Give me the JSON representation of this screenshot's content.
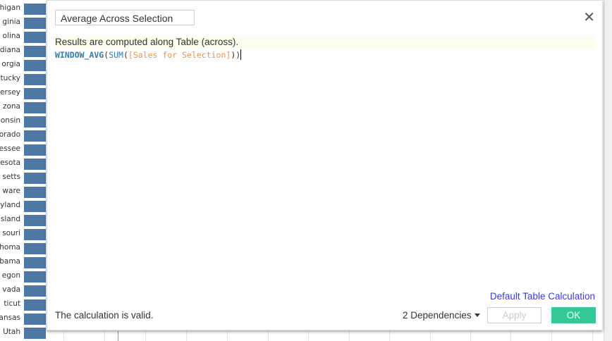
{
  "background": {
    "row_labels": [
      "higan",
      "ginia",
      "olina",
      "diana",
      "orgia",
      "tucky",
      "ersey",
      "zona",
      "onsin",
      "orado",
      "essee",
      "esota",
      "setts",
      "ware",
      "yland",
      "sland",
      "souri",
      "homa",
      "bama",
      "egon",
      "vada",
      "ticut",
      "ansas",
      "Utah"
    ]
  },
  "dialog": {
    "calc_name": "Average Across Selection",
    "info": "Results are computed along Table (across).",
    "formula": {
      "fn_outer": "WINDOW_AVG",
      "open1": "(",
      "fn_inner": "SUM",
      "open2": "(",
      "field": "[Sales for Selection]",
      "close": "))"
    },
    "default_link": "Default Table Calculation",
    "status": "The calculation is valid.",
    "dependencies": "2 Dependencies",
    "apply": "Apply",
    "ok": "OK"
  },
  "colors": {
    "bar": "#4e79a7",
    "ok": "#35c895",
    "link": "#3a3ae0"
  }
}
